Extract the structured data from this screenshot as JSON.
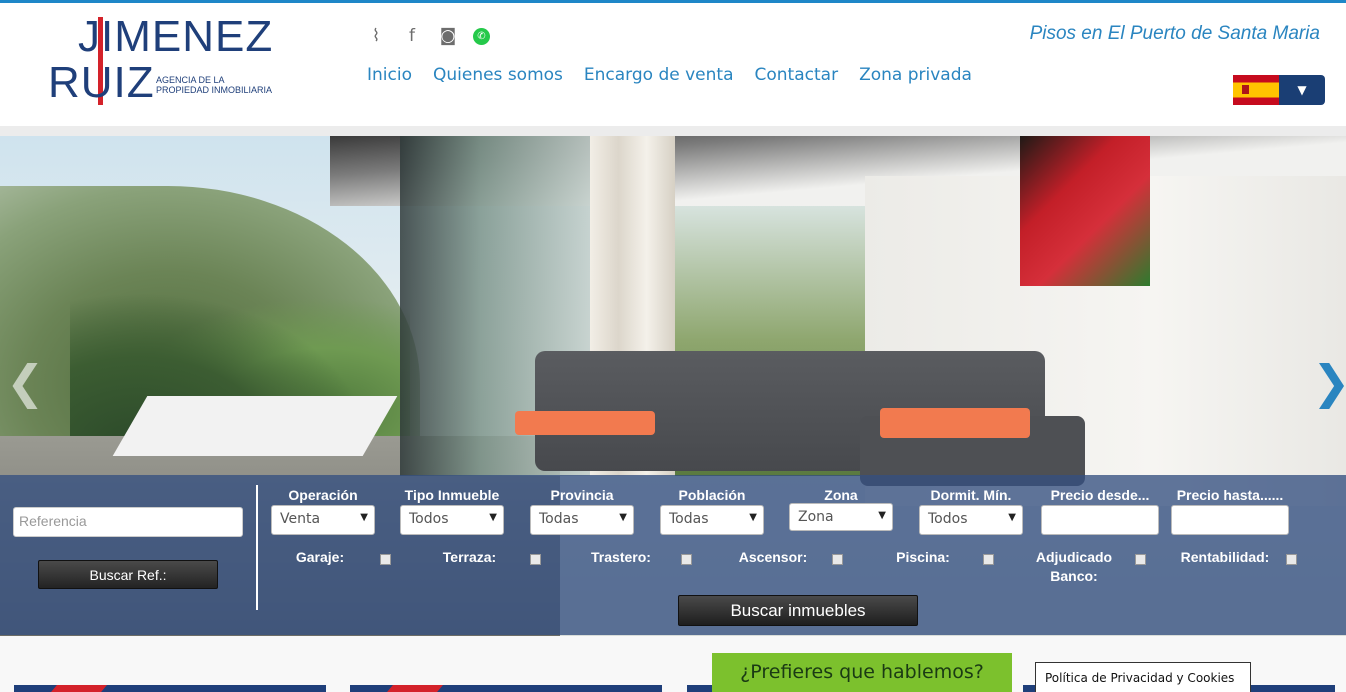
{
  "header": {
    "logo": {
      "line1": "JIMENEZ",
      "line2": "RUIZ",
      "sub": "AGENCIA DE LA PROPIEDAD INMOBILIARIA"
    },
    "social": [
      {
        "icon": "rss-icon",
        "glyph": "⌇"
      },
      {
        "icon": "facebook-icon",
        "glyph": "f"
      },
      {
        "icon": "instagram-icon",
        "glyph": "◙"
      },
      {
        "icon": "whatsapp-icon",
        "glyph": "✆"
      }
    ],
    "nav": [
      "Inicio",
      "Quienes somos",
      "Encargo de venta",
      "Contactar",
      "Zona privada"
    ],
    "tagline": "Pisos en El Puerto de Santa Maria",
    "language": {
      "flag": "spain-flag-icon",
      "dropdown_glyph": "▼"
    }
  },
  "search": {
    "reference_placeholder": "Referencia",
    "reference_button": "Buscar Ref.:",
    "fields": {
      "operacion": {
        "label": "Operación",
        "value": "Venta"
      },
      "tipo": {
        "label": "Tipo Inmueble",
        "value": "Todos"
      },
      "provincia": {
        "label": "Provincia",
        "value": "Todas"
      },
      "poblacion": {
        "label": "Población",
        "value": "Todas"
      },
      "zona": {
        "label": "Zona",
        "value": "Zona"
      },
      "dormit": {
        "label": "Dormit. Mín.",
        "value": "Todos"
      },
      "precio_desde": {
        "label": "Precio desde..."
      },
      "precio_hasta": {
        "label": "Precio hasta......"
      }
    },
    "checkboxes": {
      "garaje": "Garaje:",
      "terraza": "Terraza:",
      "trastero": "Trastero:",
      "ascensor": "Ascensor:",
      "piscina": "Piscina:",
      "adjudicado1": "Adjudicado",
      "adjudicado2": "Banco:",
      "rentabilidad": "Rentabilidad:"
    },
    "submit": "Buscar inmuebles"
  },
  "slider": {
    "prev": "❮",
    "next": "❯"
  },
  "footer": {
    "talk_button": "¿Prefieres que hablemos?",
    "privacy": "Política de Privacidad y Cookies"
  },
  "colors": {
    "accent": "#2a85c0",
    "navy": "#1f3f7a",
    "green": "#7cc12d",
    "red": "#d4222a"
  }
}
